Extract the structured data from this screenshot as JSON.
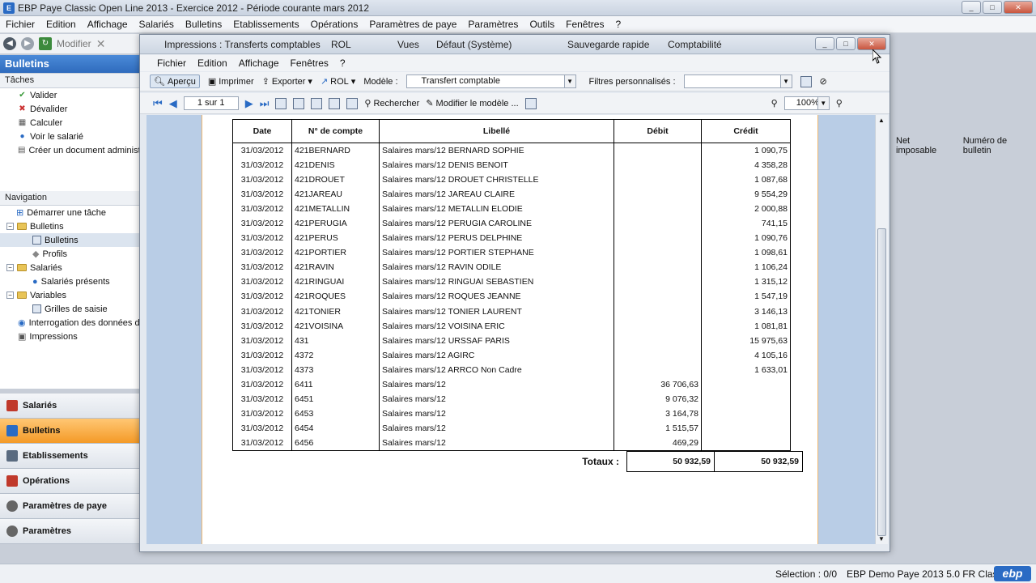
{
  "window": {
    "title": "EBP Paye Classic Open Line 2013 - Exercice 2012 - Période courante mars 2012",
    "min": "_",
    "max": "□",
    "close": "✕"
  },
  "main_menu": [
    "Fichier",
    "Edition",
    "Affichage",
    "Salariés",
    "Bulletins",
    "Etablissements",
    "Opérations",
    "Paramètres de paye",
    "Paramètres",
    "Outils",
    "Fenêtres",
    "?"
  ],
  "main_toolbar": {
    "modify": "Modifier"
  },
  "left_panel": {
    "header": "Bulletins",
    "tasks_title": "Tâches",
    "tasks": [
      "Valider",
      "Dévalider",
      "Calculer",
      "Voir le salarié",
      "Créer un document administrat"
    ],
    "nav_title": "Navigation",
    "nav": {
      "start": "Démarrer une tâche",
      "bulletins": "Bulletins",
      "bulletins_child": "Bulletins",
      "profils": "Profils",
      "salaries": "Salariés",
      "salaries_presents": "Salariés présents",
      "variables": "Variables",
      "grilles": "Grilles de saisie",
      "interrogation": "Interrogation des données de P",
      "impressions": "Impressions"
    }
  },
  "bottom_nav": [
    "Salariés",
    "Bulletins",
    "Etablissements",
    "Opérations",
    "Paramètres de paye",
    "Paramètres"
  ],
  "bg_grid_headers": [
    "Net imposable",
    "Numéro de bulletin"
  ],
  "status": {
    "selection": "Sélection : 0/0",
    "version": "EBP Demo Paye 2013 5.0 FR Classic",
    "logo": "ebp"
  },
  "dialog": {
    "title": "Impressions : Transferts comptables",
    "title_extras": {
      "rol": "ROL",
      "vues": "Vues",
      "view": "Défaut (Système)",
      "save": "Sauvegarde rapide",
      "compta": "Comptabilité"
    },
    "menu": [
      "Fichier",
      "Edition",
      "Affichage",
      "Fenêtres",
      "?"
    ],
    "toolbar1": {
      "apercu": "Aperçu",
      "imprimer": "Imprimer",
      "exporter": "Exporter",
      "rol": "ROL",
      "modele_label": "Modèle :",
      "modele_value": "Transfert comptable",
      "filtres_label": "Filtres personnalisés :"
    },
    "toolbar2": {
      "page": "1 sur 1",
      "rechercher": "Rechercher",
      "modifier": "Modifier le modèle ...",
      "zoom": "100%"
    }
  },
  "report": {
    "headers": [
      "Date",
      "N° de compte",
      "Libellé",
      "Débit",
      "Crédit"
    ],
    "rows": [
      [
        "31/03/2012",
        "421BERNARD",
        "Salaires mars/12 BERNARD SOPHIE",
        "",
        "1 090,75"
      ],
      [
        "31/03/2012",
        "421DENIS",
        "Salaires mars/12 DENIS BENOIT",
        "",
        "4 358,28"
      ],
      [
        "31/03/2012",
        "421DROUET",
        "Salaires mars/12 DROUET CHRISTELLE",
        "",
        "1 087,68"
      ],
      [
        "31/03/2012",
        "421JAREAU",
        "Salaires mars/12 JAREAU CLAIRE",
        "",
        "9 554,29"
      ],
      [
        "31/03/2012",
        "421METALLIN",
        "Salaires mars/12 METALLIN ELODIE",
        "",
        "2 000,88"
      ],
      [
        "31/03/2012",
        "421PERUGIA",
        "Salaires mars/12 PERUGIA CAROLINE",
        "",
        "741,15"
      ],
      [
        "31/03/2012",
        "421PERUS",
        "Salaires mars/12 PERUS DELPHINE",
        "",
        "1 090,76"
      ],
      [
        "31/03/2012",
        "421PORTIER",
        "Salaires mars/12 PORTIER STEPHANE",
        "",
        "1 098,61"
      ],
      [
        "31/03/2012",
        "421RAVIN",
        "Salaires mars/12 RAVIN ODILE",
        "",
        "1 106,24"
      ],
      [
        "31/03/2012",
        "421RINGUAI",
        "Salaires mars/12 RINGUAI SEBASTIEN",
        "",
        "1 315,12"
      ],
      [
        "31/03/2012",
        "421ROQUES",
        "Salaires mars/12 ROQUES JEANNE",
        "",
        "1 547,19"
      ],
      [
        "31/03/2012",
        "421TONIER",
        "Salaires mars/12 TONIER LAURENT",
        "",
        "3 146,13"
      ],
      [
        "31/03/2012",
        "421VOISINA",
        "Salaires mars/12 VOISINA ERIC",
        "",
        "1 081,81"
      ],
      [
        "31/03/2012",
        "431",
        "Salaires mars/12 URSSAF PARIS",
        "",
        "15 975,63"
      ],
      [
        "31/03/2012",
        "4372",
        "Salaires mars/12 AGIRC",
        "",
        "4 105,16"
      ],
      [
        "31/03/2012",
        "4373",
        "Salaires mars/12 ARRCO Non Cadre",
        "",
        "1 633,01"
      ],
      [
        "31/03/2012",
        "6411",
        "Salaires mars/12",
        "36 706,63",
        ""
      ],
      [
        "31/03/2012",
        "6451",
        "Salaires mars/12",
        "9 076,32",
        ""
      ],
      [
        "31/03/2012",
        "6453",
        "Salaires mars/12",
        "3 164,78",
        ""
      ],
      [
        "31/03/2012",
        "6454",
        "Salaires mars/12",
        "1 515,57",
        ""
      ],
      [
        "31/03/2012",
        "6456",
        "Salaires mars/12",
        "469,29",
        ""
      ]
    ],
    "totals_label": "Totaux :",
    "total_debit": "50 932,59",
    "total_credit": "50 932,59"
  }
}
